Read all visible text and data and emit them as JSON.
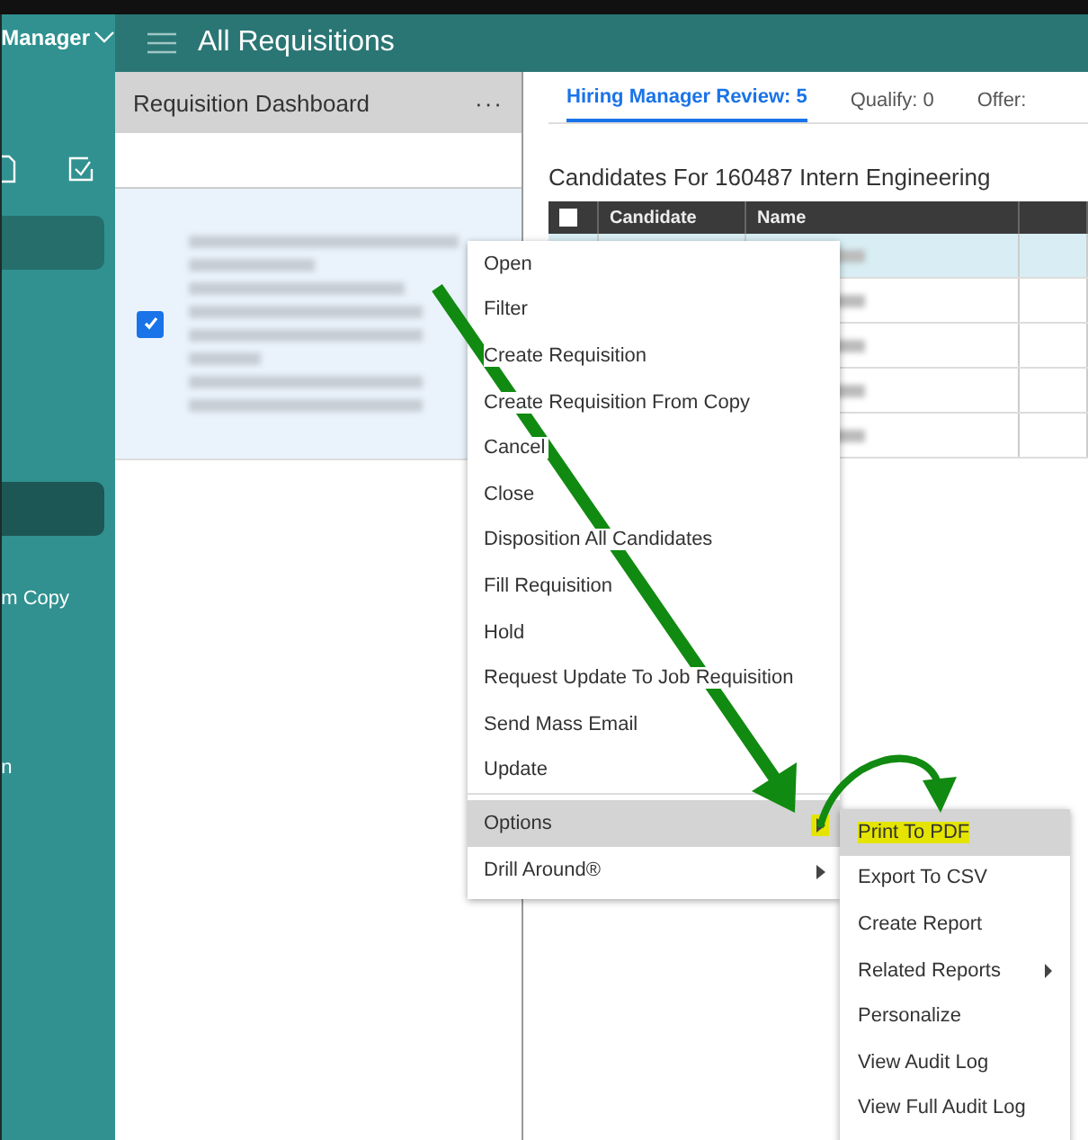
{
  "sidebar": {
    "menu_label": "Manager",
    "items": [
      {
        "selected": true
      },
      {
        "selected": true
      },
      {
        "label": "m Copy",
        "selected": false
      },
      {
        "label": "n",
        "selected": false
      }
    ]
  },
  "header": {
    "title": "All Requisitions"
  },
  "left_panel": {
    "title": "Requisition Dashboard",
    "more": "···",
    "card": {
      "checked": true
    }
  },
  "tabs": [
    {
      "label": "Hiring Manager Review: 5",
      "selected": true
    },
    {
      "label": "Qualify: 0",
      "selected": false
    },
    {
      "label": "Offer:",
      "selected": false
    }
  ],
  "candidates": {
    "title": "Candidates For 160487 Intern Engineering",
    "columns": [
      "Candidate",
      "Name"
    ],
    "all_selected": false,
    "rows": [
      {
        "selected": true
      },
      {
        "selected": false
      },
      {
        "selected": false
      },
      {
        "selected": false
      },
      {
        "selected": false
      }
    ]
  },
  "context_menu": [
    {
      "label": "Open",
      "selected": false,
      "submenu": false
    },
    {
      "label": "Filter",
      "selected": false,
      "submenu": false
    },
    {
      "label": "Create Requisition",
      "selected": false,
      "submenu": false
    },
    {
      "label": "Create Requisition From Copy",
      "selected": false,
      "submenu": false
    },
    {
      "label": "Cancel",
      "selected": false,
      "submenu": false
    },
    {
      "label": "Close",
      "selected": false,
      "submenu": false
    },
    {
      "label": "Disposition All Candidates",
      "selected": false,
      "submenu": false
    },
    {
      "label": "Fill Requisition",
      "selected": false,
      "submenu": false
    },
    {
      "label": "Hold",
      "selected": false,
      "submenu": false
    },
    {
      "label": "Request Update To Job Requisition",
      "selected": false,
      "submenu": false
    },
    {
      "label": "Send Mass Email",
      "selected": false,
      "submenu": false
    },
    {
      "label": "Update",
      "selected": false,
      "submenu": false
    },
    {
      "label": "Options",
      "selected": true,
      "submenu": true,
      "highlighted": true
    },
    {
      "label": "Drill Around®",
      "selected": false,
      "submenu": true,
      "highlighted": false
    }
  ],
  "options_menu": [
    {
      "label": "Print To PDF",
      "selected": true,
      "highlighted": true,
      "submenu": false
    },
    {
      "label": "Export To CSV",
      "selected": false,
      "highlighted": false,
      "submenu": false
    },
    {
      "label": "Create Report",
      "selected": false,
      "highlighted": false,
      "submenu": false
    },
    {
      "label": "Related Reports",
      "selected": false,
      "highlighted": false,
      "submenu": true
    },
    {
      "label": "Personalize",
      "selected": false,
      "highlighted": false,
      "submenu": false
    },
    {
      "label": "View Audit Log",
      "selected": false,
      "highlighted": false,
      "submenu": false
    },
    {
      "label": "View Full Audit Log",
      "selected": false,
      "highlighted": false,
      "submenu": false
    }
  ]
}
